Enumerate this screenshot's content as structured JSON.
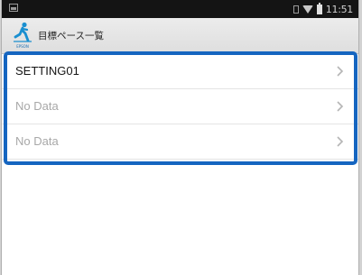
{
  "status_bar": {
    "time": "11:51",
    "icons": [
      "notification-icon",
      "sim-icon",
      "wifi-icon",
      "battery-icon"
    ]
  },
  "action_bar": {
    "title": "目標ペース一覧",
    "logo_text": "EPSON"
  },
  "list": {
    "items": [
      {
        "label": "SETTING01",
        "state": "filled"
      },
      {
        "label": "No Data",
        "state": "empty"
      },
      {
        "label": "No Data",
        "state": "empty"
      }
    ]
  },
  "colors": {
    "highlight": "#1565c0",
    "brand": "#1a6fb3",
    "muted_text": "#a8a8a8"
  }
}
